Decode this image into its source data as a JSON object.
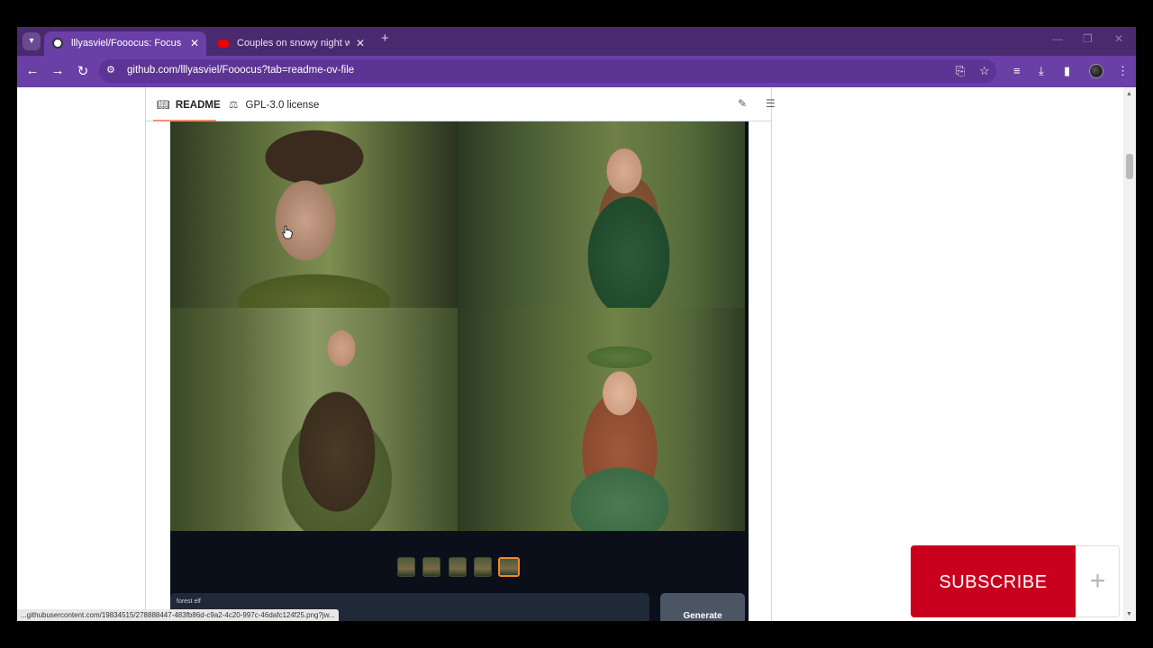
{
  "browser": {
    "tabs": [
      {
        "title": "lllyasviel/Fooocus: Focus on pro",
        "active": true
      },
      {
        "title": "Couples on snowy night walking",
        "active": false
      }
    ],
    "url": "github.com/lllyasviel/Fooocus?tab=readme-ov-file",
    "status_url": "...githubusercontent.com/19834515/278888447-483fb86d-c9a2-4c20-997c-46dafc124f25.png?jw..."
  },
  "readme": {
    "tabs": [
      {
        "label": "README",
        "icon": "book-icon",
        "active": true
      },
      {
        "label": "GPL-3.0 license",
        "icon": "scale-icon",
        "active": false
      }
    ]
  },
  "app": {
    "prompt_value": "forest elf",
    "generate_label": "Generate",
    "thumbnail_count": 5,
    "selected_thumbnail": 5
  },
  "overlay": {
    "subscribe_label": "SUBSCRIBE",
    "plus_label": "+"
  },
  "colors": {
    "tabbar": "#4a2a6e",
    "toolbar": "#6a3fa6",
    "subscribe": "#c8001e",
    "readme_underline": "#fd8c73"
  }
}
